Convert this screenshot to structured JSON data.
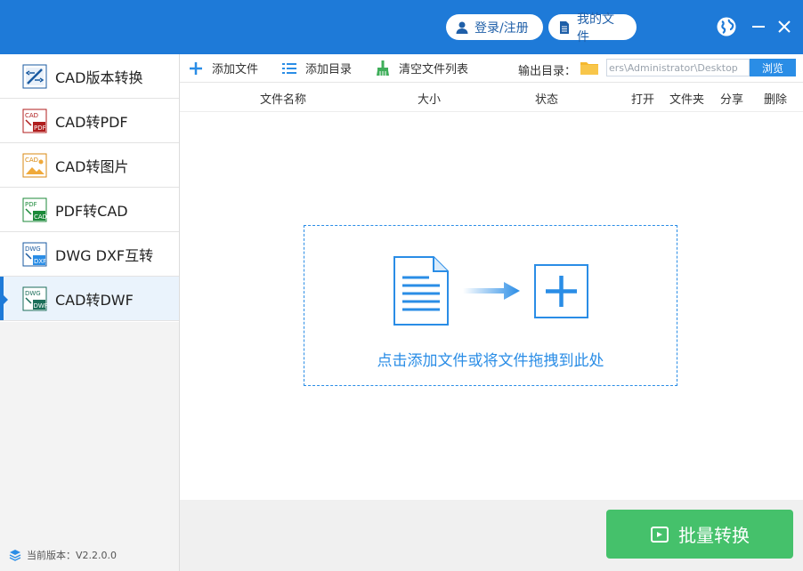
{
  "header": {
    "login_label": "登录/注册",
    "myfiles_label": "我的文件",
    "colors": {
      "title_bar": "#1e7ad8",
      "accent": "#2a8de6",
      "convert": "#45c16b"
    }
  },
  "sidebar": {
    "items": [
      {
        "label": "CAD版本转换",
        "icon": "cad-version-convert-icon"
      },
      {
        "label": "CAD转PDF",
        "icon": "cad-to-pdf-icon"
      },
      {
        "label": "CAD转图片",
        "icon": "cad-to-image-icon"
      },
      {
        "label": "PDF转CAD",
        "icon": "pdf-to-cad-icon"
      },
      {
        "label": "DWG DXF互转",
        "icon": "dwg-dxf-convert-icon"
      },
      {
        "label": "CAD转DWF",
        "icon": "cad-to-dwf-icon",
        "active": true
      }
    ],
    "version": "当前版本：V2.2.0.0"
  },
  "toolbar": {
    "add_file": "添加文件",
    "add_folder": "添加目录",
    "clear_list": "清空文件列表",
    "output_dir_label": "输出目录：",
    "output_dir_value": "ers\\Administrator\\Desktop",
    "browse": "浏览"
  },
  "table": {
    "columns": [
      "文件名称",
      "大小",
      "状态",
      "打开",
      "文件夹",
      "分享",
      "删除"
    ]
  },
  "dropzone": {
    "text": "点击添加文件或将文件拖拽到此处"
  },
  "footer": {
    "convert_label": "批量转换"
  }
}
